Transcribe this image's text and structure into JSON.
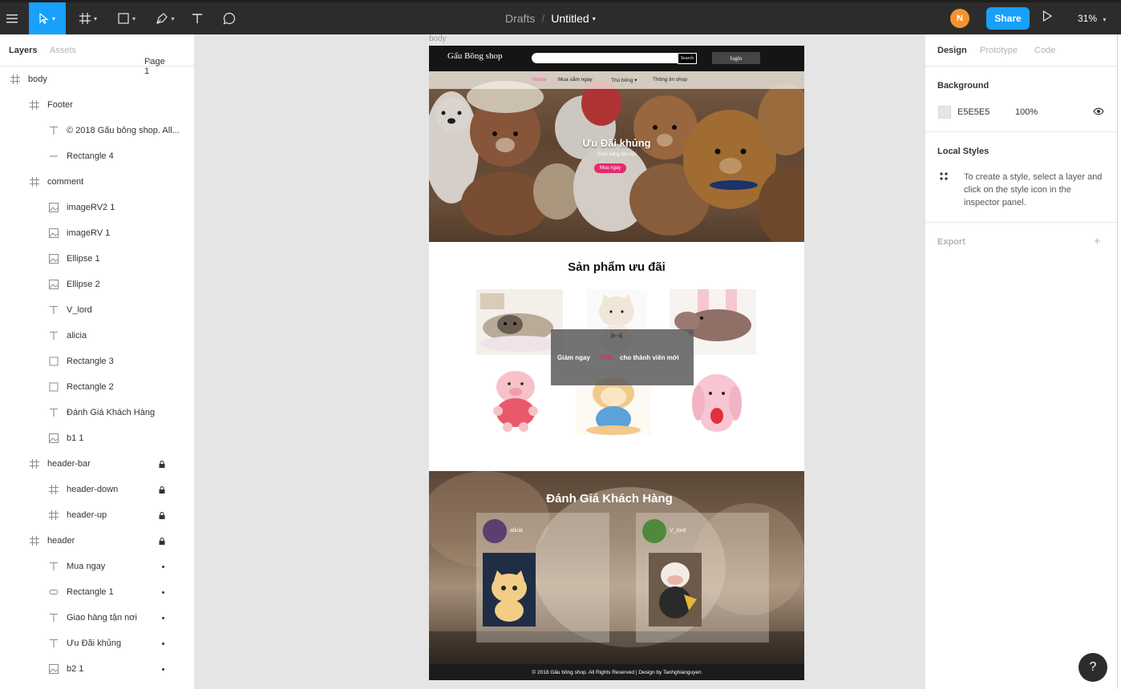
{
  "toolbar": {
    "breadcrumb_parent": "Drafts",
    "breadcrumb_sep": "/",
    "file_name": "Untitled",
    "avatar_initial": "N",
    "share_label": "Share",
    "zoom_label": "31%",
    "accent": "#18a0fb",
    "avatar_color": "#f5922f"
  },
  "left_panel": {
    "tab_layers": "Layers",
    "tab_assets": "Assets",
    "page_selector": "Page 1",
    "layers": [
      {
        "label": "body",
        "icon": "frame-icon",
        "indent": 0,
        "status": ""
      },
      {
        "label": "Footer",
        "icon": "frame-icon",
        "indent": 1,
        "status": ""
      },
      {
        "label": "© 2018 Gấu bông shop. All...",
        "icon": "text-icon",
        "indent": 2,
        "status": ""
      },
      {
        "label": "Rectangle 4",
        "icon": "line-icon",
        "indent": 2,
        "status": ""
      },
      {
        "label": "comment",
        "icon": "frame-icon",
        "indent": 1,
        "status": ""
      },
      {
        "label": "imageRV2 1",
        "icon": "image-icon",
        "indent": 2,
        "status": ""
      },
      {
        "label": "imageRV 1",
        "icon": "image-icon",
        "indent": 2,
        "status": ""
      },
      {
        "label": "Ellipse 1",
        "icon": "image-icon",
        "indent": 2,
        "status": ""
      },
      {
        "label": "Ellipse 2",
        "icon": "image-icon",
        "indent": 2,
        "status": ""
      },
      {
        "label": "V_lord",
        "icon": "text-icon",
        "indent": 2,
        "status": ""
      },
      {
        "label": "alicia",
        "icon": "text-icon",
        "indent": 2,
        "status": ""
      },
      {
        "label": "Rectangle 3",
        "icon": "rectangle-icon",
        "indent": 2,
        "status": ""
      },
      {
        "label": "Rectangle 2",
        "icon": "rectangle-icon",
        "indent": 2,
        "status": ""
      },
      {
        "label": "Đánh Giá Khách Hàng",
        "icon": "text-icon",
        "indent": 2,
        "status": ""
      },
      {
        "label": "b1 1",
        "icon": "image-icon",
        "indent": 2,
        "status": ""
      },
      {
        "label": "header-bar",
        "icon": "frame-icon",
        "indent": 1,
        "status": "locked"
      },
      {
        "label": "header-down",
        "icon": "frame-icon",
        "indent": 2,
        "status": "locked"
      },
      {
        "label": "header-up",
        "icon": "frame-icon",
        "indent": 2,
        "status": "locked"
      },
      {
        "label": "header",
        "icon": "frame-icon",
        "indent": 1,
        "status": "locked"
      },
      {
        "label": "Mua ngay",
        "icon": "text-icon",
        "indent": 2,
        "status": "dot"
      },
      {
        "label": "Rectangle 1",
        "icon": "rounded-rect-icon",
        "indent": 2,
        "status": "dot"
      },
      {
        "label": "Giao hàng tận nơi",
        "icon": "text-icon",
        "indent": 2,
        "status": "dot"
      },
      {
        "label": "Ưu Đãi khủng",
        "icon": "text-icon",
        "indent": 2,
        "status": "dot"
      },
      {
        "label": "b2 1",
        "icon": "image-icon",
        "indent": 2,
        "status": "dot"
      }
    ]
  },
  "right_panel": {
    "tab_design": "Design",
    "tab_prototype": "Prototype",
    "tab_code": "Code",
    "background_title": "Background",
    "background_hex": "E5E5E5",
    "background_opacity": "100%",
    "background_color": "#e5e5e5",
    "local_styles_title": "Local Styles",
    "local_styles_hint": "To create a style, select a layer and click on the style icon in the inspector panel.",
    "export_title": "Export",
    "export_add": "+",
    "help_label": "?"
  },
  "canvas": {
    "frame_label": "body",
    "site": {
      "brand": "Gấu Bông shop",
      "search_label": "Search",
      "login_label": "login",
      "nav": [
        "Home",
        "Mua sắm ngay",
        "Thú bông ▾",
        "Thông tin shop"
      ],
      "hero_title": "Ưu Đãi  khủng",
      "hero_sub": "Giao hàng tận nơi",
      "hero_btn": "Mua ngay",
      "products_title": "Sản phẩm ưu đãi",
      "promo_left": "Giảm ngay",
      "promo_pct": "10%",
      "promo_right": "cho thành viên mới",
      "reviews_title": "Đánh Giá Khách Hàng",
      "reviewers": [
        "alicia",
        "V_lord"
      ],
      "footer": "© 2018 Gấu bông shop. All Rights Reserved | Design by Tanhghianguyen",
      "brand_pink": "#e8286f"
    }
  }
}
